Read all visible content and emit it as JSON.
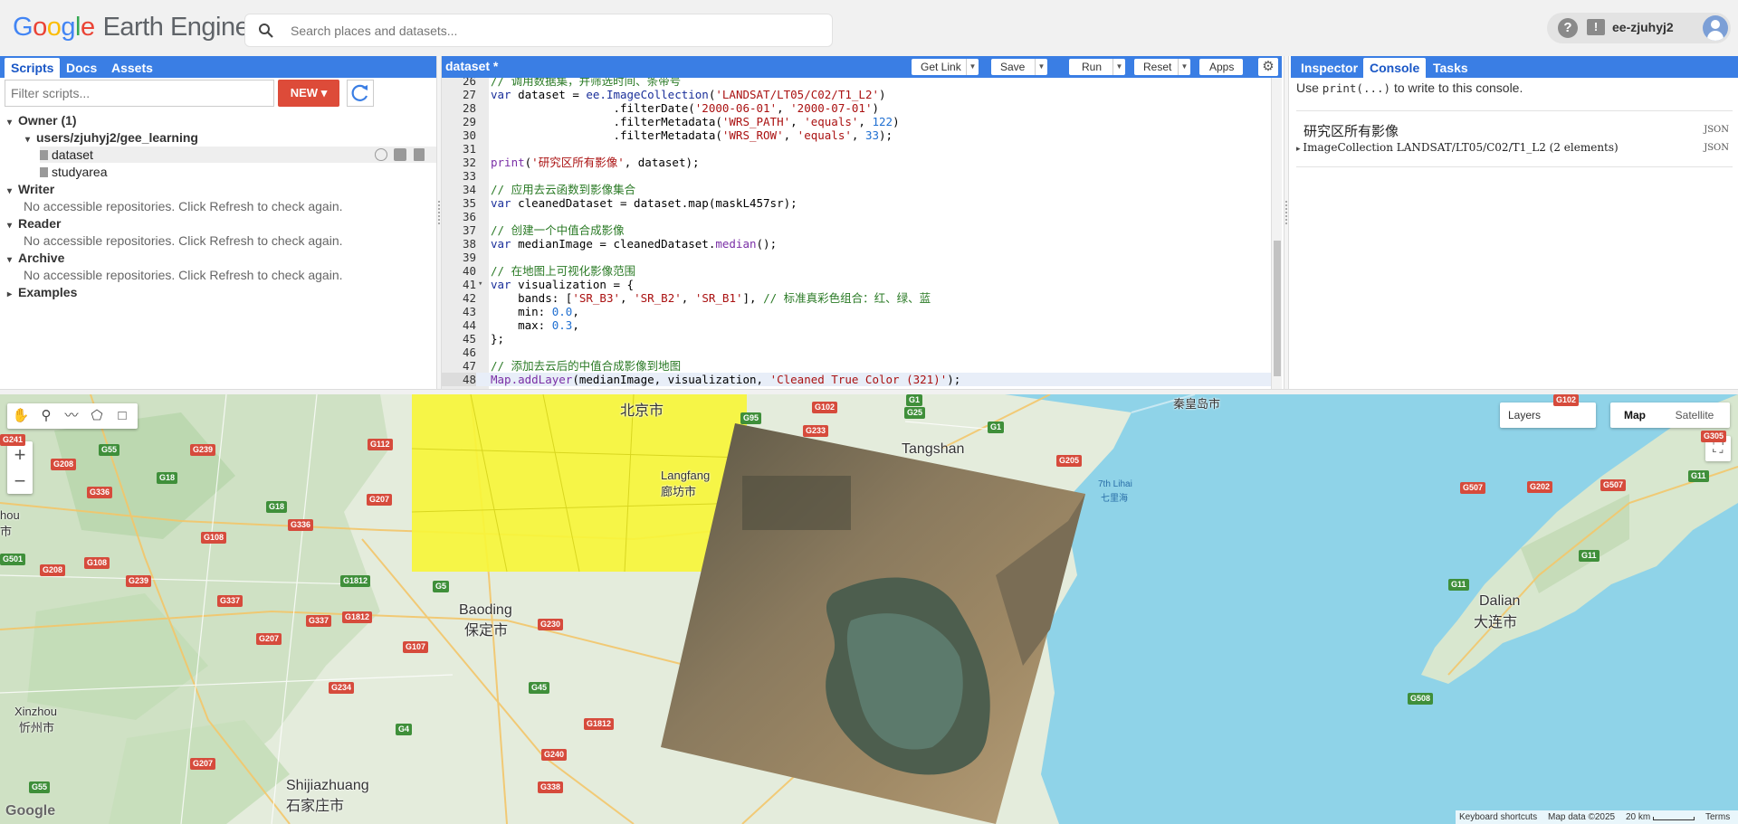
{
  "header": {
    "logo_g": [
      "G",
      "o",
      "o",
      "g",
      "l",
      "e"
    ],
    "logo_rest": "Earth Engine",
    "search_placeholder": "Search places and datasets...",
    "help_icon": "?",
    "feedback_icon": "!",
    "user": "ee-zjuhyj2"
  },
  "left": {
    "tabs": [
      "Scripts",
      "Docs",
      "Assets"
    ],
    "filter_placeholder": "Filter scripts...",
    "new_button": "NEW",
    "tree": [
      {
        "label": "Owner (1)",
        "type": "group"
      },
      {
        "label": "users/zjuhyj2/gee_learning",
        "type": "repo"
      },
      {
        "label": "dataset",
        "type": "file"
      },
      {
        "label": "studyarea",
        "type": "file"
      },
      {
        "label": "Writer",
        "type": "group"
      },
      {
        "label": "No accessible repositories. Click Refresh to check again.",
        "type": "msg"
      },
      {
        "label": "Reader",
        "type": "group"
      },
      {
        "label": "No accessible repositories. Click Refresh to check again.",
        "type": "msg"
      },
      {
        "label": "Archive",
        "type": "group"
      },
      {
        "label": "No accessible repositories. Click Refresh to check again.",
        "type": "msg"
      },
      {
        "label": "Examples",
        "type": "group"
      }
    ]
  },
  "editor": {
    "title": "dataset *",
    "buttons": [
      "Get Link",
      "Save",
      "Run",
      "Reset",
      "Apps"
    ],
    "lines": [
      {
        "n": "26",
        "segs": [
          [
            "c",
            "// 调用数据集，并筛选时间、条带号"
          ]
        ]
      },
      {
        "n": "27",
        "segs": [
          [
            "k",
            "var "
          ],
          [
            "v",
            "dataset = "
          ],
          [
            "k",
            "ee.ImageCollection"
          ],
          [
            "v",
            "("
          ],
          [
            "s",
            "'LANDSAT/LT05/C02/T1_L2'"
          ],
          [
            "v",
            ")"
          ]
        ]
      },
      {
        "n": "28",
        "segs": [
          [
            "v",
            "                  .filterDate("
          ],
          [
            "s",
            "'2000-06-01'"
          ],
          [
            "v",
            ", "
          ],
          [
            "s",
            "'2000-07-01'"
          ],
          [
            "v",
            ")"
          ]
        ]
      },
      {
        "n": "29",
        "segs": [
          [
            "v",
            "                  .filterMetadata("
          ],
          [
            "s",
            "'WRS_PATH'"
          ],
          [
            "v",
            ", "
          ],
          [
            "s",
            "'equals'"
          ],
          [
            "v",
            ", "
          ],
          [
            "n",
            "122"
          ],
          [
            "v",
            ")"
          ]
        ]
      },
      {
        "n": "30",
        "segs": [
          [
            "v",
            "                  .filterMetadata("
          ],
          [
            "s",
            "'WRS_ROW'"
          ],
          [
            "v",
            ", "
          ],
          [
            "s",
            "'equals'"
          ],
          [
            "v",
            ", "
          ],
          [
            "n",
            "33"
          ],
          [
            "v",
            ");"
          ]
        ]
      },
      {
        "n": "31",
        "segs": []
      },
      {
        "n": "32",
        "segs": [
          [
            "f",
            "print"
          ],
          [
            "v",
            "("
          ],
          [
            "s",
            "'研究区所有影像'"
          ],
          [
            "v",
            ", dataset);"
          ]
        ]
      },
      {
        "n": "33",
        "segs": []
      },
      {
        "n": "34",
        "segs": [
          [
            "c",
            "// 应用去云函数到影像集合"
          ]
        ]
      },
      {
        "n": "35",
        "segs": [
          [
            "k",
            "var "
          ],
          [
            "v",
            "cleanedDataset = dataset.map(maskL457sr);"
          ]
        ]
      },
      {
        "n": "36",
        "segs": []
      },
      {
        "n": "37",
        "segs": [
          [
            "c",
            "// 创建一个中值合成影像"
          ]
        ]
      },
      {
        "n": "38",
        "segs": [
          [
            "k",
            "var "
          ],
          [
            "v",
            "medianImage = cleanedDataset."
          ],
          [
            "f",
            "median"
          ],
          [
            "v",
            "();"
          ]
        ]
      },
      {
        "n": "39",
        "segs": []
      },
      {
        "n": "40",
        "segs": [
          [
            "c",
            "// 在地图上可视化影像范围"
          ]
        ]
      },
      {
        "n": "41",
        "segs": [
          [
            "k",
            "var "
          ],
          [
            "v",
            "visualization = {"
          ]
        ]
      },
      {
        "n": "42",
        "segs": [
          [
            "v",
            "    bands: ["
          ],
          [
            "s",
            "'SR_B3'"
          ],
          [
            "v",
            ", "
          ],
          [
            "s",
            "'SR_B2'"
          ],
          [
            "v",
            ", "
          ],
          [
            "s",
            "'SR_B1'"
          ],
          [
            "v",
            "], "
          ],
          [
            "c",
            "// 标准真彩色组合：红、绿、蓝"
          ]
        ]
      },
      {
        "n": "43",
        "segs": [
          [
            "v",
            "    min: "
          ],
          [
            "n",
            "0.0"
          ],
          [
            "v",
            ","
          ]
        ]
      },
      {
        "n": "44",
        "segs": [
          [
            "v",
            "    max: "
          ],
          [
            "n",
            "0.3"
          ],
          [
            "v",
            ","
          ]
        ]
      },
      {
        "n": "45",
        "segs": [
          [
            "v",
            "};"
          ]
        ]
      },
      {
        "n": "46",
        "segs": []
      },
      {
        "n": "47",
        "segs": [
          [
            "c",
            "// 添加去云后的中值合成影像到地图"
          ]
        ]
      },
      {
        "n": "48",
        "segs": [
          [
            "f",
            "Map.addLayer"
          ],
          [
            "v",
            "(medianImage, visualization, "
          ],
          [
            "s",
            "'Cleaned True Color (321)'"
          ],
          [
            "v",
            ");"
          ]
        ]
      }
    ]
  },
  "right": {
    "tabs": [
      "Inspector",
      "Console",
      "Tasks"
    ],
    "hint_pre": "Use ",
    "hint_code": "print(...)",
    "hint_post": " to write to this console.",
    "out_label": "研究区所有影像",
    "out_collection": "ImageCollection LANDSAT/LT05/C02/T1_L2 (2 elements)",
    "json": "JSON"
  },
  "map": {
    "layers": "Layers",
    "map_button": "Map",
    "satellite_button": "Satellite",
    "labels": [
      {
        "t": "北京市",
        "cls": "big"
      },
      {
        "t": "秦皇岛市",
        "cls": "mid"
      },
      {
        "t": "Tangshan",
        "cls": "big"
      },
      {
        "t": "Langfang",
        "cls": "mid"
      },
      {
        "t": "廊坊市",
        "cls": "mid"
      },
      {
        "t": "Baoding",
        "cls": "big"
      },
      {
        "t": "保定市",
        "cls": "big"
      },
      {
        "t": "Dalian",
        "cls": "big"
      },
      {
        "t": "大连市",
        "cls": "big"
      },
      {
        "t": "Xinzhou",
        "cls": "mid"
      },
      {
        "t": "忻州市",
        "cls": "mid"
      },
      {
        "t": "Shijiazhuang",
        "cls": "big"
      },
      {
        "t": "石家庄市",
        "cls": "big"
      },
      {
        "t": "hou",
        "cls": "mid"
      },
      {
        "t": "市",
        "cls": "mid"
      },
      {
        "t": "7th Lihai",
        "cls": "sea"
      },
      {
        "t": "七里海",
        "cls": "sea"
      }
    ],
    "shields": [
      "G95",
      "G25",
      "G102",
      "G233",
      "G1",
      "G205",
      "G239",
      "G55",
      "G112",
      "G208",
      "G18",
      "G336",
      "G207",
      "G18",
      "G336",
      "G108",
      "G108",
      "G239",
      "G337",
      "G1812",
      "G207",
      "G337",
      "G1812",
      "G5",
      "G107",
      "G230",
      "G45",
      "G234",
      "G4",
      "G1812",
      "G240",
      "G207",
      "G338",
      "G55",
      "G508",
      "G11",
      "G507",
      "G202",
      "G507",
      "G11",
      "G11",
      "G305",
      "G102",
      "G1",
      "G501",
      "G208",
      "G241"
    ],
    "keyboard": "Keyboard shortcuts",
    "mapdata": "Map data ©2025",
    "scale": "20 km",
    "terms": "Terms",
    "google": "Google"
  },
  "colors": {
    "accent": "#3a7ee4",
    "new_button": "#dd4b39",
    "study_area": "#f7f53a",
    "sea": "#8fd3e8"
  }
}
